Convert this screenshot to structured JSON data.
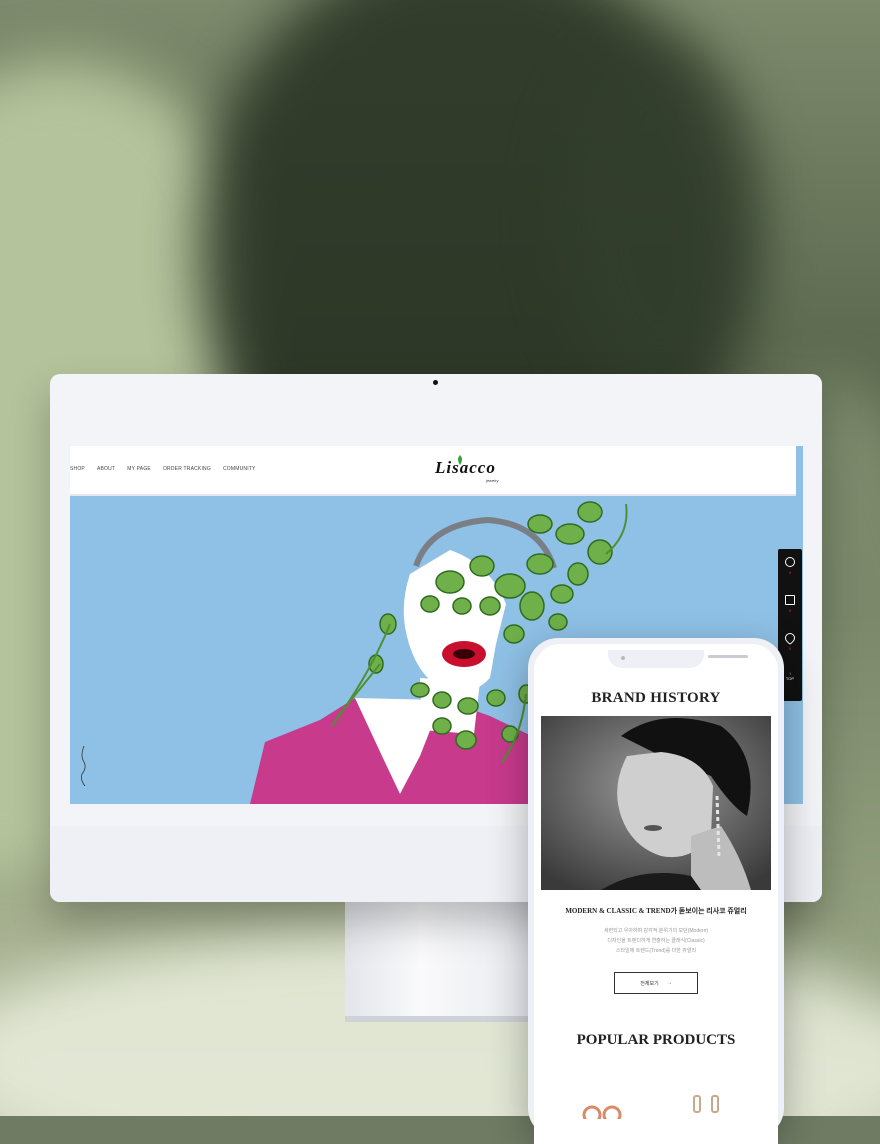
{
  "desktop": {
    "nav": [
      "SHOP",
      "ABOUT",
      "MY PAGE",
      "ORDER TRACKING",
      "COMMUNITY"
    ],
    "logo": "Lisacco",
    "logo_sub": "jewelry",
    "dock": {
      "counts": [
        "0",
        "0",
        "0"
      ],
      "top_label": "TOP"
    }
  },
  "mobile": {
    "brand_title": "BRAND HISTORY",
    "tagline": "MODERN & CLASSIC & TREND가 돋보이는 리사코 쥬얼리",
    "description": [
      "세련되고 우아하며 감각적 분위기의 모던(Modern)",
      "디자인을 트렌디하게 연출하는 클래식(Classic)",
      "스타일에 트렌드(Trend)를 더한 쥬얼리"
    ],
    "more_label": "전체보기",
    "more_arrow": "→",
    "popular_title": "POPULAR PRODUCTS"
  },
  "colors": {
    "hero_sky": "#8fc1e6",
    "jacket": "#c73a8c",
    "gem_green": "#6fb04a",
    "dock": "#111111"
  }
}
